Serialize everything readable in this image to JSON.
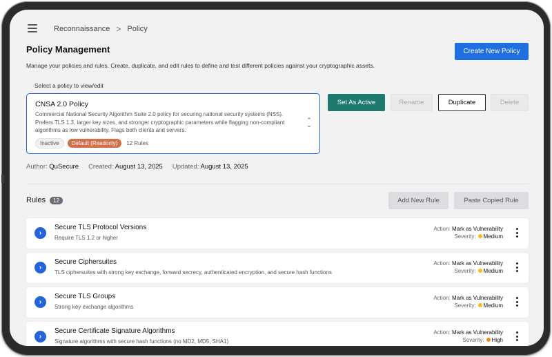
{
  "breadcrumb": {
    "items": [
      "Reconnaissance",
      "Policy"
    ],
    "separator": ">"
  },
  "header": {
    "title": "Policy Management",
    "description": "Manage your policies and rules. Create, duplicate, and edit rules to define and test different policies against your cryptographic assets.",
    "create_button": "Create New Policy"
  },
  "policy_select": {
    "label": "Select a policy to view/edit",
    "name": "CNSA 2.0 Policy",
    "description": "Commercial National Security Algorithm Suite 2.0 policy for securing national security systems (NSS). Prefers TLS 1.3, larger key sizes, and stronger cryptographic parameters while flagging non-compliant algorithms as low vulnerability. Flags both clients and servers.",
    "status_tag": "Inactive",
    "default_tag": "Default (Readonly)",
    "rule_count": "12 Rules"
  },
  "actions": {
    "set_active": "Set As Active",
    "rename": "Rename",
    "duplicate": "Duplicate",
    "delete": "Delete"
  },
  "meta": {
    "author_label": "Author:",
    "author": "QuSecure",
    "created_label": "Created:",
    "created": "August 13, 2025",
    "updated_label": "Updated:",
    "updated": "August 13, 2025"
  },
  "rules_section": {
    "title": "Rules",
    "count": "12",
    "add_button": "Add New Rule",
    "paste_button": "Paste Copied Rule"
  },
  "rules": [
    {
      "name": "Secure TLS Protocol Versions",
      "description": "Require TLS 1.2 or higher",
      "action_label": "Action:",
      "action": "Mark as Vulnerability",
      "severity_label": "Severity:",
      "severity": "Medium",
      "severity_color": "#f0c020"
    },
    {
      "name": "Secure Ciphersuites",
      "description": "TLS ciphersuites with strong key exchange, forward secrecy, authenticated encryption, and secure hash functions",
      "action_label": "Action:",
      "action": "Mark as Vulnerability",
      "severity_label": "Severity:",
      "severity": "Medium",
      "severity_color": "#f0c020"
    },
    {
      "name": "Secure TLS Groups",
      "description": "Strong key exchange algorithms",
      "action_label": "Action:",
      "action": "Mark as Vulnerability",
      "severity_label": "Severity:",
      "severity": "Medium",
      "severity_color": "#f0c020"
    },
    {
      "name": "Secure Certificate Signature Algorithms",
      "description": "Signature algorithms with secure hash functions (no MD2, MD5, SHA1)",
      "action_label": "Action:",
      "action": "Mark as Vulnerability",
      "severity_label": "Severity:",
      "severity": "High",
      "severity_color": "#f08a24"
    }
  ],
  "colors": {
    "primary": "#1f6fe0",
    "teal": "#1f7a6e",
    "default_tag": "#d2704a",
    "medium": "#f0c020",
    "high": "#f08a24"
  }
}
